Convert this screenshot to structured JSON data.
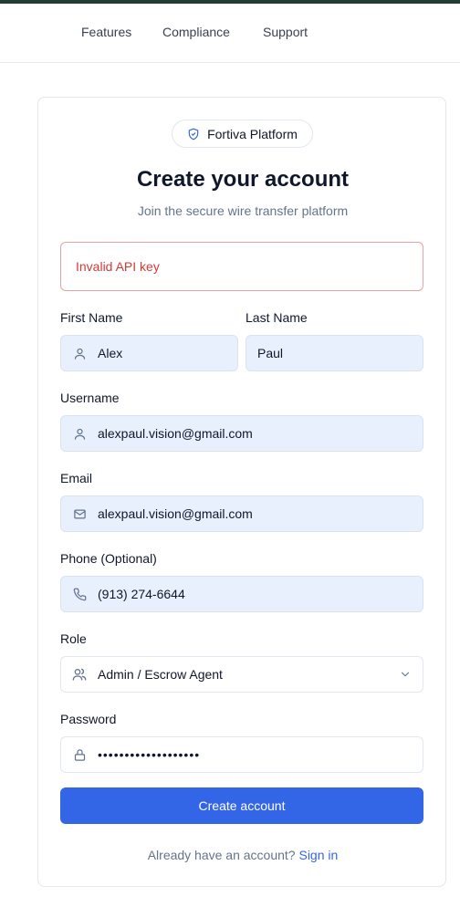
{
  "nav": {
    "items": [
      "Features",
      "Compliance",
      "Support"
    ]
  },
  "badge": {
    "label": "Fortiva Platform"
  },
  "heading": {
    "title": "Create your account",
    "subtitle": "Join the secure wire transfer platform"
  },
  "alert": {
    "message": "Invalid API key"
  },
  "form": {
    "first_name": {
      "label": "First Name",
      "value": "Alex"
    },
    "last_name": {
      "label": "Last Name",
      "value": "Paul"
    },
    "username": {
      "label": "Username",
      "value": "alexpaul.vision@gmail.com"
    },
    "email": {
      "label": "Email",
      "value": "alexpaul.vision@gmail.com"
    },
    "phone": {
      "label": "Phone (Optional)",
      "value": "(913) 274-6644"
    },
    "role": {
      "label": "Role",
      "value": "Admin / Escrow Agent"
    },
    "password": {
      "label": "Password",
      "value": "•••••••••••••••••••"
    },
    "submit_label": "Create account"
  },
  "footer": {
    "prompt": "Already have an account?",
    "link": "Sign in"
  },
  "colors": {
    "accent": "#3366e6",
    "error": "#d33a3a",
    "autofill": "#e8f0fe",
    "topbar": "#223d34"
  }
}
